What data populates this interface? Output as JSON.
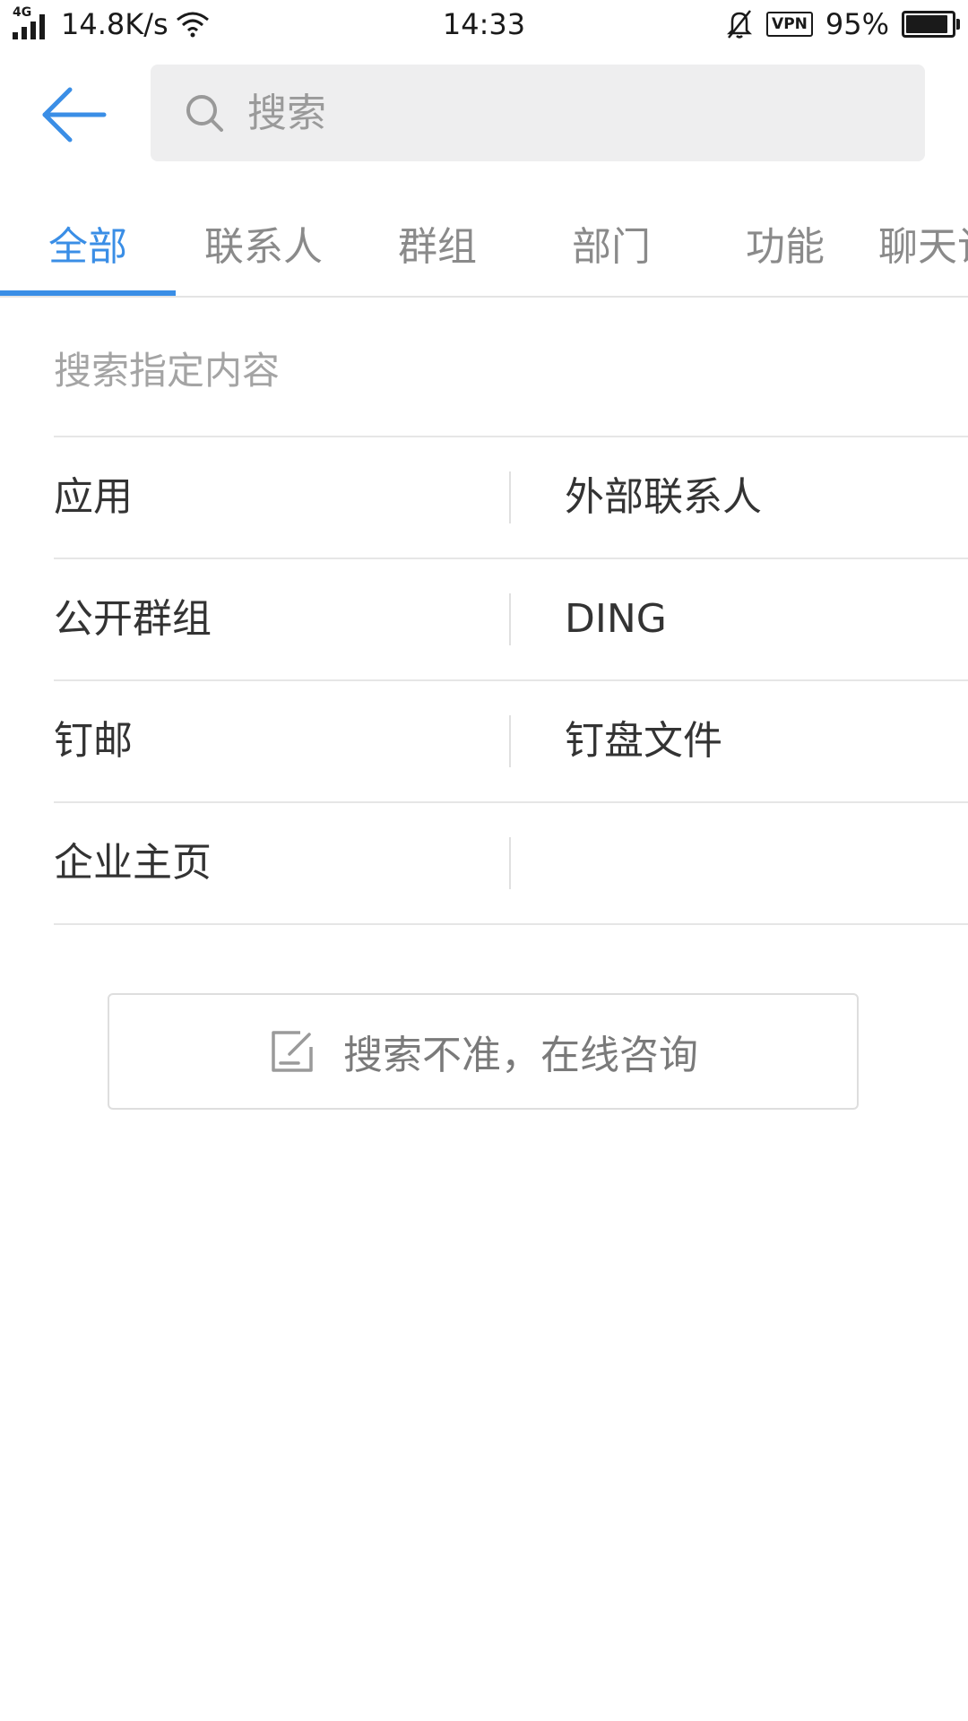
{
  "status_bar": {
    "network_type": "4G",
    "net_speed": "14.8K/s",
    "time": "14:33",
    "vpn_label": "VPN",
    "battery_percent_text": "95%",
    "battery_level": 0.95,
    "icons": [
      "signal-icon",
      "wifi-icon",
      "bell-muted-icon",
      "vpn-icon",
      "battery-icon"
    ]
  },
  "header": {
    "back_icon": "arrow-left-icon",
    "search": {
      "placeholder": "搜索",
      "value": "",
      "icon": "search-icon"
    }
  },
  "tabs": [
    {
      "label": "全部",
      "active": true
    },
    {
      "label": "联系人",
      "active": false
    },
    {
      "label": "群组",
      "active": false
    },
    {
      "label": "部门",
      "active": false
    },
    {
      "label": "功能",
      "active": false
    },
    {
      "label": "聊天记录",
      "active": false
    }
  ],
  "section": {
    "title": "搜索指定内容",
    "items": [
      [
        "应用",
        "外部联系人"
      ],
      [
        "公开群组",
        "DING"
      ],
      [
        "钉邮",
        "钉盘文件"
      ],
      [
        "企业主页",
        ""
      ]
    ]
  },
  "feedback": {
    "label": "搜索不准，在线咨询",
    "icon": "edit-note-icon"
  },
  "colors": {
    "accent": "#3a8ee6",
    "search_bg": "#eeeeef",
    "divider": "#e6e6e6",
    "muted_text": "#8a8a8a"
  }
}
